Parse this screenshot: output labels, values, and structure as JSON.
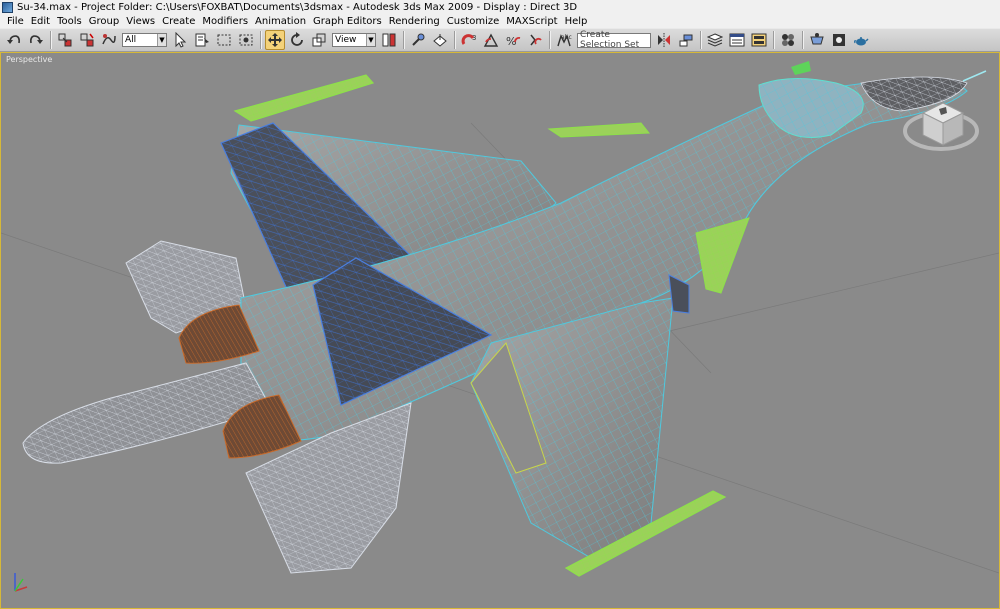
{
  "window": {
    "title": "Su-34.max     - Project Folder: C:\\Users\\FOXBAT\\Documents\\3dsmax     - Autodesk 3ds Max  2009        - Display : Direct 3D"
  },
  "menu": {
    "items": [
      "File",
      "Edit",
      "Tools",
      "Group",
      "Views",
      "Create",
      "Modifiers",
      "Animation",
      "Graph Editors",
      "Rendering",
      "Customize",
      "MAXScript",
      "Help"
    ]
  },
  "toolbar": {
    "filter_value": "All",
    "refcoord_value": "View",
    "named_selection_placeholder": "Create Selection Set"
  },
  "viewport": {
    "label": "Perspective"
  },
  "colors": {
    "wire_cyan": "#4fc9de",
    "wire_blue": "#4a7fe0",
    "wire_green": "#8ee04a",
    "wire_orange": "#c86a2a",
    "wire_white": "#d8dde6",
    "viewport_bg": "#8a8a8a"
  }
}
